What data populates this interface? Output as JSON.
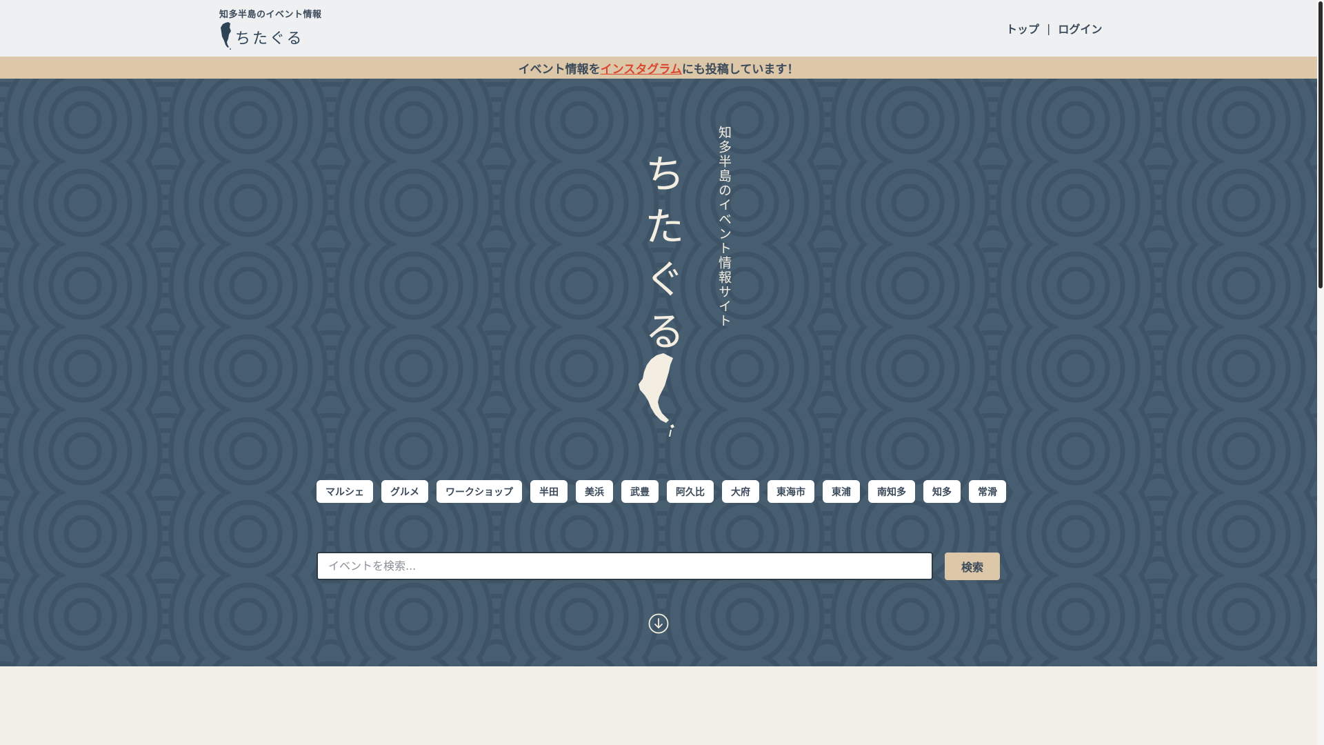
{
  "header": {
    "tagline": "知多半島のイベント情報",
    "logo_text": "ちたぐる",
    "nav": {
      "top": "トップ",
      "separator": "|",
      "login": "ログイン"
    }
  },
  "announcement": {
    "before": "イベント情報を",
    "link": "インスタグラム",
    "after": "にも投稿しています！"
  },
  "hero": {
    "title": "ちたぐる",
    "subtitle": "知多半島のイベント情報サイト"
  },
  "tags": [
    "マルシェ",
    "グルメ",
    "ワークショップ",
    "半田",
    "美浜",
    "武豊",
    "阿久比",
    "大府",
    "東海市",
    "東浦",
    "南知多",
    "知多",
    "常滑"
  ],
  "search": {
    "placeholder": "イベントを検索...",
    "button": "検索"
  },
  "icons": {
    "logo": "chita-peninsula-icon",
    "scroll": "arrow-down-circle-icon"
  },
  "colors": {
    "hero_bg": "#475e70",
    "announce_bg": "#dcc7a8",
    "link": "#d9472f",
    "text": "#3b4a5a",
    "page_bg": "#f3f0e8"
  }
}
